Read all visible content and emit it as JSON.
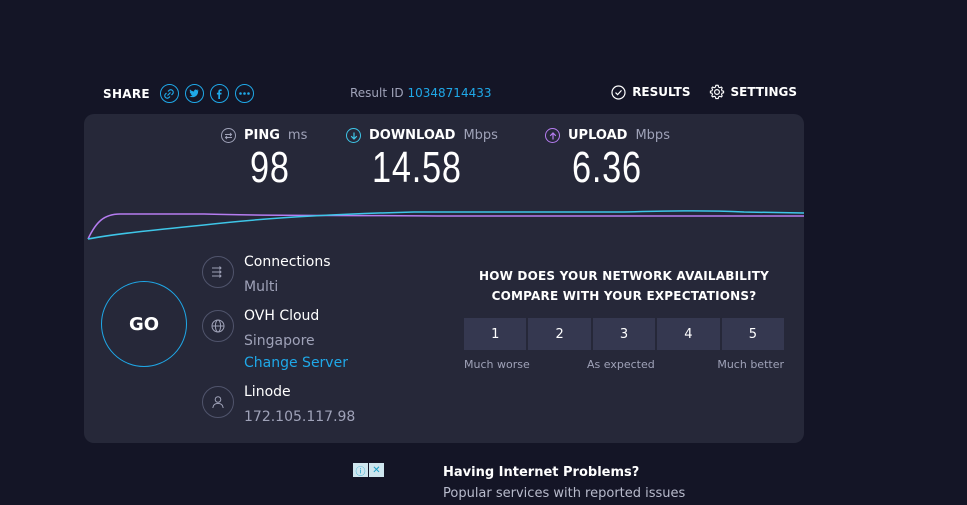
{
  "header": {
    "share_label": "SHARE",
    "share_buttons": [
      "link-icon",
      "twitter-icon",
      "facebook-icon",
      "more-icon"
    ],
    "result_id_label": "Result ID",
    "result_id": "10348714433",
    "results_label": "RESULTS",
    "settings_label": "SETTINGS"
  },
  "metrics": {
    "ping": {
      "label": "PING",
      "unit": "ms",
      "value": "98"
    },
    "download": {
      "label": "DOWNLOAD",
      "unit": "Mbps",
      "value": "14.58"
    },
    "upload": {
      "label": "UPLOAD",
      "unit": "Mbps",
      "value": "6.36"
    }
  },
  "go_label": "GO",
  "connections": {
    "label": "Connections",
    "value": "Multi"
  },
  "server": {
    "name": "OVH Cloud",
    "location": "Singapore",
    "change_label": "Change Server"
  },
  "provider": {
    "name": "Linode",
    "ip": "172.105.117.98"
  },
  "survey": {
    "question_line1": "HOW DOES YOUR NETWORK AVAILABILITY",
    "question_line2": "COMPARE WITH YOUR EXPECTATIONS?",
    "options": [
      "1",
      "2",
      "3",
      "4",
      "5"
    ],
    "label_low": "Much worse",
    "label_mid": "As expected",
    "label_high": "Much better"
  },
  "promo": {
    "heading": "Having Internet Problems?",
    "subtext": "Popular services with reported issues"
  },
  "colors": {
    "accent": "#1fa8e8",
    "download_line": "#3ec6e8",
    "upload_line": "#b57cf0",
    "panel": "#262839",
    "background": "#141526"
  }
}
